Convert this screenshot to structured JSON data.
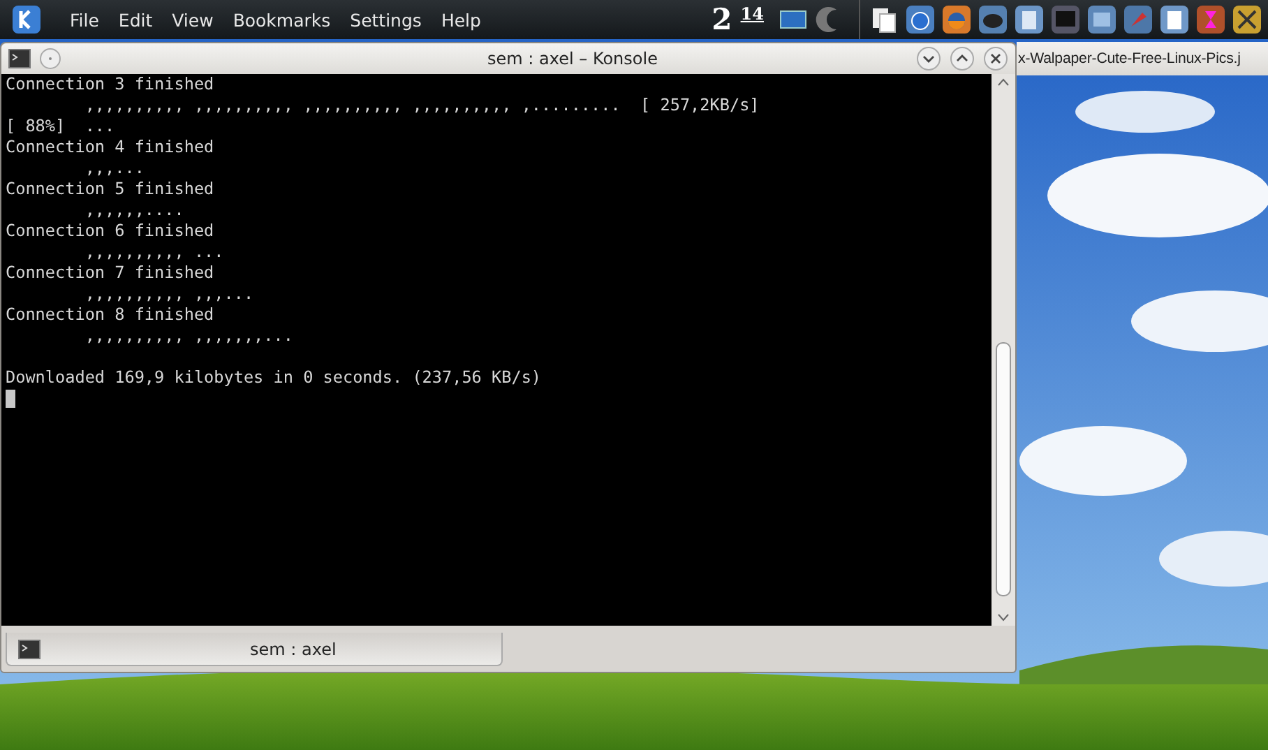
{
  "panel": {
    "menu": [
      "File",
      "Edit",
      "View",
      "Bookmarks",
      "Settings",
      "Help"
    ],
    "clock": {
      "hour": "2",
      "minute": "14"
    }
  },
  "background_window": {
    "title": "x-Walpaper-Cute-Free-Linux-Pics.j"
  },
  "konsole": {
    "title": "sem : axel – Konsole",
    "lines": [
      {
        "kind": "plain",
        "text": "Connection 3 finished"
      },
      {
        "kind": "plain",
        "text": "        ,,,,,,,,,, ,,,,,,,,,, ,,,,,,,,,, ,,,,,,,,,, ,.........  [ 257,2KB/s]"
      },
      {
        "kind": "plain",
        "text": "[ 88%]  ..."
      },
      {
        "kind": "plain",
        "text": "Connection 4 finished"
      },
      {
        "kind": "plain",
        "text": "        ,,,..."
      },
      {
        "kind": "plain",
        "text": "Connection 5 finished"
      },
      {
        "kind": "plain",
        "text": "        ,,,,,,...."
      },
      {
        "kind": "plain",
        "text": "Connection 6 finished"
      },
      {
        "kind": "plain",
        "text": "        ,,,,,,,,,, ..."
      },
      {
        "kind": "plain",
        "text": "Connection 7 finished"
      },
      {
        "kind": "plain",
        "text": "        ,,,,,,,,,, ,,,..."
      },
      {
        "kind": "plain",
        "text": "Connection 8 finished"
      },
      {
        "kind": "plain",
        "text": "        ,,,,,,,,,, ,,,,,,,..."
      },
      {
        "kind": "summary",
        "text": "Downloaded 169,9 kilobytes in 0 seconds. (237,56 KB/s)"
      }
    ],
    "tabs": [
      {
        "label": "sem : axel",
        "selected": true
      }
    ]
  }
}
